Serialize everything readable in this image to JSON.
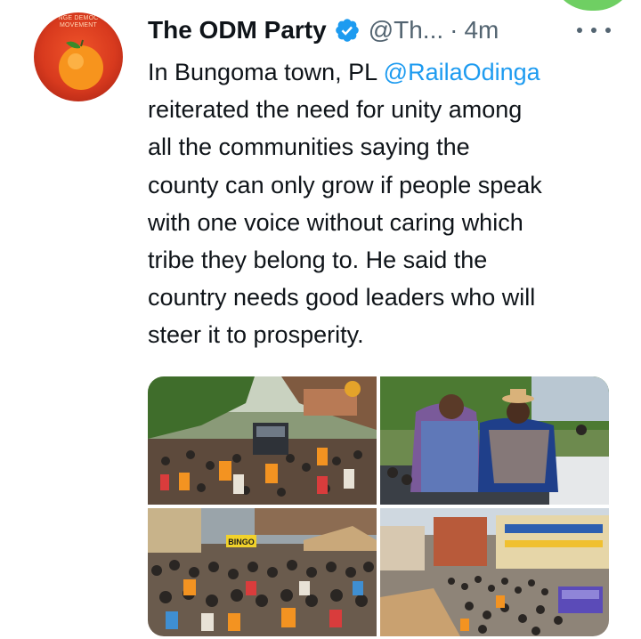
{
  "tweet": {
    "author": {
      "name": "The ODM Party",
      "handle": "@Th...",
      "separator": "·",
      "time": "4m",
      "avatar_text_line1": "NGE DEMOC",
      "avatar_text_line2": "MOVEMENT"
    },
    "text": {
      "line1_prefix": "In Bungoma town, PL ",
      "mention": "@RailaOdinga",
      "line2": "reiterated the need for unity among",
      "line3": "all the communities saying the",
      "line4": "county can only grow if people speak",
      "line5": "with one voice without caring which",
      "line6": "tribe they belong to. He said the",
      "line7": "country needs good leaders who will",
      "line8": "steer it to prosperity."
    },
    "media": {
      "photo3_sign": "BINGO"
    }
  },
  "icons": {
    "verified": "verified-badge-icon",
    "more": "more-options-icon"
  },
  "colors": {
    "accent": "#1d9bf0",
    "text_primary": "#0f1419",
    "text_secondary": "#536471",
    "verified": "#1d9bf0"
  }
}
